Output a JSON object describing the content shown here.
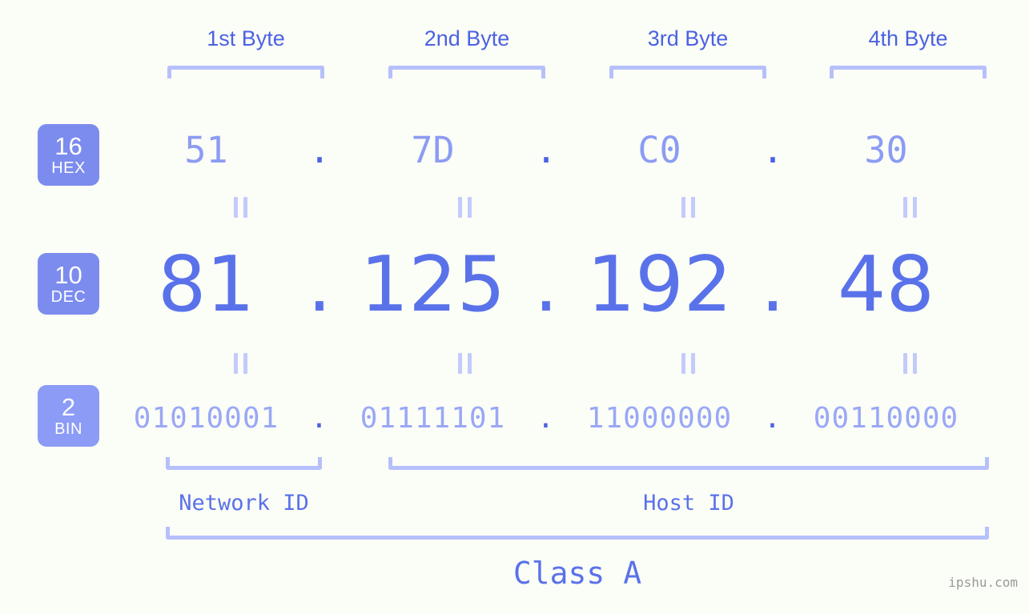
{
  "page": {
    "background_color": "#fbfdf7",
    "accent_color": "#5a72e9",
    "light_accent_color": "#b6c0fb",
    "badge_color": "#7c8cee",
    "watermark": "ipshu.com"
  },
  "byte_headers": [
    {
      "label": "1st Byte"
    },
    {
      "label": "2nd Byte"
    },
    {
      "label": "3rd Byte"
    },
    {
      "label": "4th Byte"
    }
  ],
  "bases": [
    {
      "number": "16",
      "system": "HEX"
    },
    {
      "number": "10",
      "system": "DEC"
    },
    {
      "number": "2",
      "system": "BIN"
    }
  ],
  "separator": ".",
  "rows": {
    "hex": {
      "values": [
        "51",
        "7D",
        "C0",
        "30"
      ]
    },
    "dec": {
      "values": [
        "81",
        "125",
        "192",
        "48"
      ]
    },
    "bin": {
      "values": [
        "01010001",
        "01111101",
        "11000000",
        "00110000"
      ]
    }
  },
  "segments": {
    "network_id": "Network ID",
    "host_id": "Host ID",
    "class": "Class A"
  },
  "chart_data": {
    "type": "table",
    "title": "IP address 81.125.192.48 byte breakdown",
    "columns": [
      "1st Byte",
      "2nd Byte",
      "3rd Byte",
      "4th Byte"
    ],
    "rows": [
      {
        "base": "16",
        "system": "HEX",
        "values": [
          "51",
          "7D",
          "C0",
          "30"
        ]
      },
      {
        "base": "10",
        "system": "DEC",
        "values": [
          "81",
          "125",
          "192",
          "48"
        ]
      },
      {
        "base": "2",
        "system": "BIN",
        "values": [
          "01010001",
          "01111101",
          "11000000",
          "00110000"
        ]
      }
    ],
    "annotations": [
      {
        "label": "Network ID",
        "spans_bytes": [
          1,
          1
        ]
      },
      {
        "label": "Host ID",
        "spans_bytes": [
          2,
          4
        ]
      },
      {
        "label": "Class A",
        "spans_bytes": [
          1,
          4
        ]
      }
    ]
  }
}
